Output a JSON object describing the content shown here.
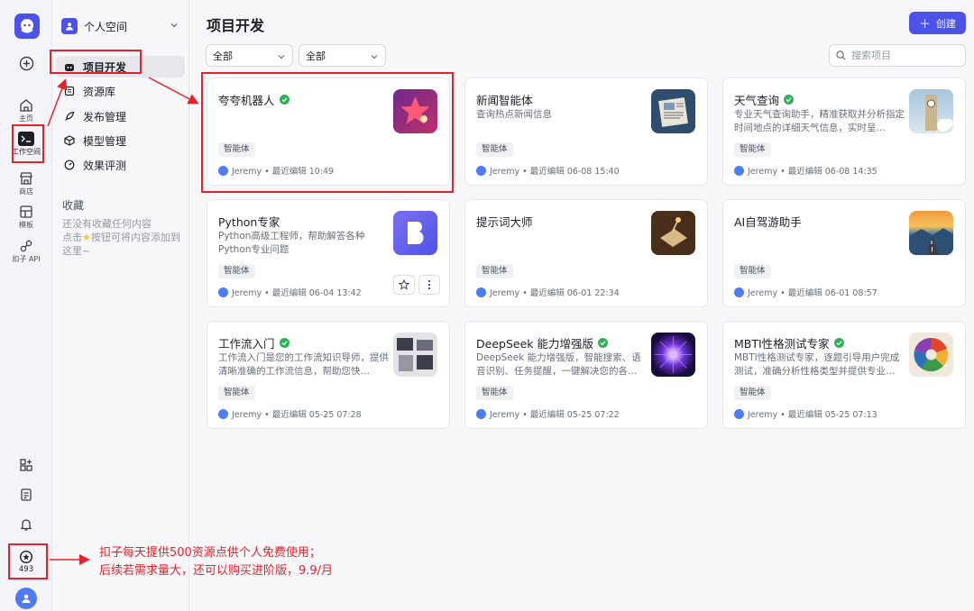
{
  "rail": {
    "items": [
      {
        "label": "主页"
      },
      {
        "label": "工作空间"
      },
      {
        "label": "商店"
      },
      {
        "label": "模板"
      },
      {
        "label": "扣子 API"
      }
    ],
    "points": "493"
  },
  "side": {
    "space_name": "个人空间",
    "nav": [
      {
        "label": "项目开发"
      },
      {
        "label": "资源库"
      },
      {
        "label": "发布管理"
      },
      {
        "label": "模型管理"
      },
      {
        "label": "效果评测"
      }
    ],
    "favorites_title": "收藏",
    "favorites_empty_1": "还没有收藏任何内容",
    "favorites_empty_2": "点击",
    "favorites_empty_3": "按钮可将内容添加到这里~"
  },
  "main": {
    "title": "项目开发",
    "create_label": "创建",
    "filter1": "全部",
    "filter2": "全部",
    "search_placeholder": "搜索项目"
  },
  "cards": [
    {
      "name": "夸夸机器人",
      "verified": true,
      "desc": "",
      "tag": "智能体",
      "meta": "Jeremy • 最近编辑 10:49"
    },
    {
      "name": "新闻智能体",
      "verified": false,
      "desc": "查询热点新闻信息",
      "tag": "智能体",
      "meta": "Jeremy • 最近编辑 06-08 15:40"
    },
    {
      "name": "天气查询",
      "verified": true,
      "desc": "专业天气查询助手，精准获取并分析指定时间地点的详细天气信息，实时呈…",
      "tag": "智能体",
      "meta": "Jeremy • 最近编辑 06-08 14:35"
    },
    {
      "name": "Python专家",
      "verified": false,
      "desc": "Python高级工程师，帮助解答各种Python专业问题",
      "tag": "智能体",
      "meta": "Jeremy • 最近编辑 06-04 13:42"
    },
    {
      "name": "提示词大师",
      "verified": false,
      "desc": "",
      "tag": "智能体",
      "meta": "Jeremy • 最近编辑 06-01 22:34"
    },
    {
      "name": "AI自驾游助手",
      "verified": false,
      "desc": "",
      "tag": "智能体",
      "meta": "Jeremy • 最近编辑 06-01 08:57"
    },
    {
      "name": "工作流入门",
      "verified": true,
      "desc": "工作流入门是您的工作流知识导师，提供清晰准确的工作流信息，帮助您快…",
      "tag": "智能体",
      "meta": "Jeremy • 最近编辑 05-25 07:28"
    },
    {
      "name": "DeepSeek 能力增强版",
      "verified": true,
      "desc": "DeepSeek 能力增强版，智能搜索、语音识别、任务提醒，一键解决您的各…",
      "tag": "智能体",
      "meta": "Jeremy • 最近编辑 05-25 07:22"
    },
    {
      "name": "MBTI性格测试专家",
      "verified": true,
      "desc": "MBTI性格测试专家，逐题引导用户完成测试，准确分析性格类型并提供专业…",
      "tag": "智能体",
      "meta": "Jeremy • 最近编辑 05-25 07:13"
    }
  ],
  "annotation": {
    "line1": "扣子每天提供500资源点供个人免费使用；",
    "line2": "后续若需求量大，还可以购买进阶版，9.9/月"
  },
  "colors": {
    "accent": "#4d53e8",
    "annotation": "#e3222b",
    "verified": "#2eb354"
  }
}
